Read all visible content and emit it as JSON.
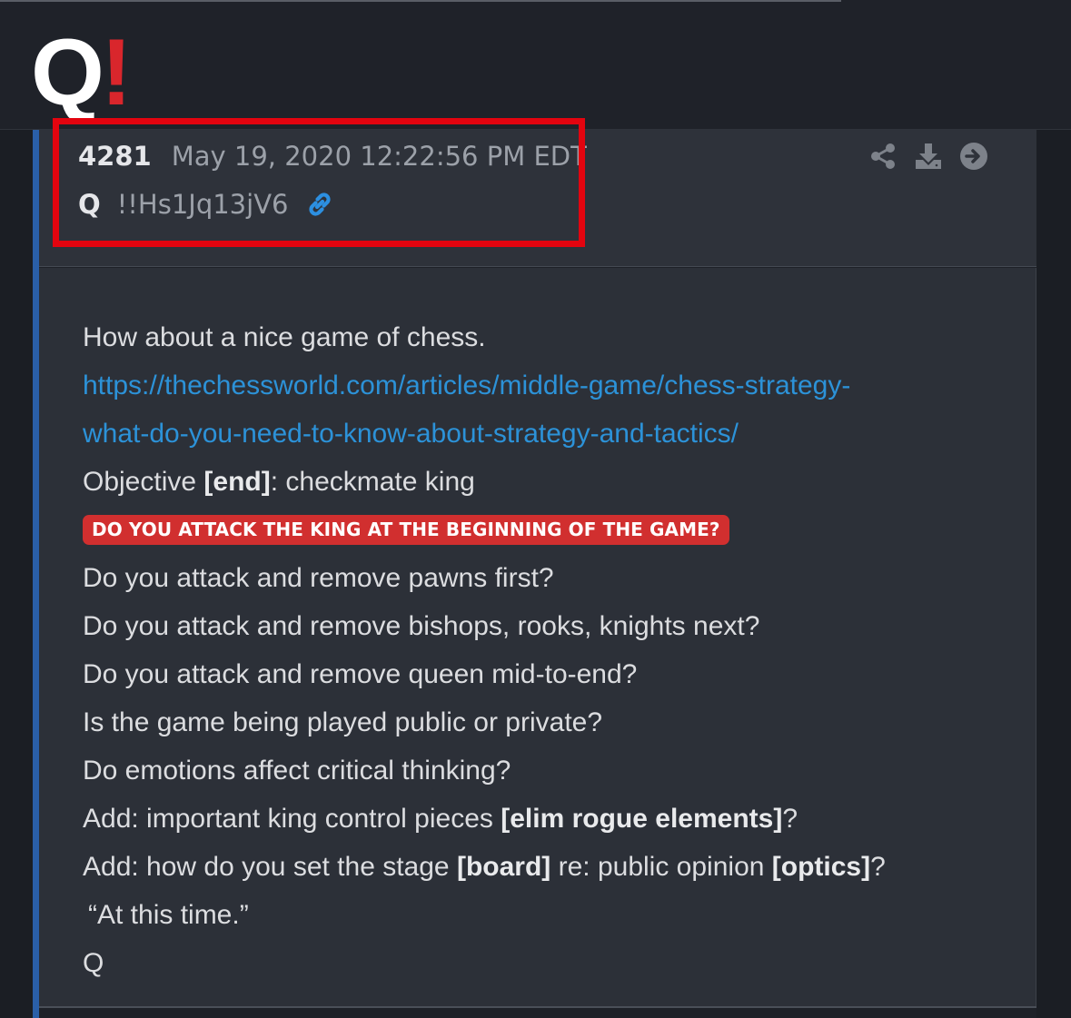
{
  "header": {
    "logo_q": "Q",
    "logo_bang": "!"
  },
  "post": {
    "number": "4281",
    "date": "May 19, 2020 12:22:56 PM EDT",
    "author": "Q",
    "tripcode": "!!Hs1Jq13jV6",
    "actions": [
      "share-icon",
      "download-icon",
      "arrow-right-circle-icon"
    ]
  },
  "body": {
    "line1": "How about a nice game of chess.",
    "url_part1": "https://thechessworld.com/articles/middle-game/chess-strategy-",
    "url_part2": "what-do-you-need-to-know-about-strategy-and-tactics/",
    "objective_prefix": "Objective ",
    "objective_bold": "[end]",
    "objective_suffix": ": checkmate king",
    "badge": "DO YOU ATTACK THE KING AT THE BEGINNING OF THE GAME?",
    "q1": "Do you attack and remove pawns first?",
    "q2": "Do you attack and remove bishops, rooks, knights next?",
    "q3": "Do you attack and remove queen mid-to-end?",
    "q4": "Is the game being played public or private?",
    "q5": "Do emotions affect critical thinking?",
    "add1_prefix": "Add: important king control pieces ",
    "add1_bold": "[elim rogue elements]",
    "add1_suffix": "?",
    "add2_prefix": "Add: how do you set the stage ",
    "add2_bold1": "[board]",
    "add2_middle": " re: public opinion ",
    "add2_bold2": "[optics]",
    "add2_suffix": "?",
    "quote": "“At this time.”",
    "signature": "Q"
  },
  "colors": {
    "accent_bar": "#2a5fa8",
    "highlight_border": "#e3040f",
    "link": "#2c92d8",
    "badge_bg": "#d12f2f",
    "logo_red": "#d9262c"
  }
}
